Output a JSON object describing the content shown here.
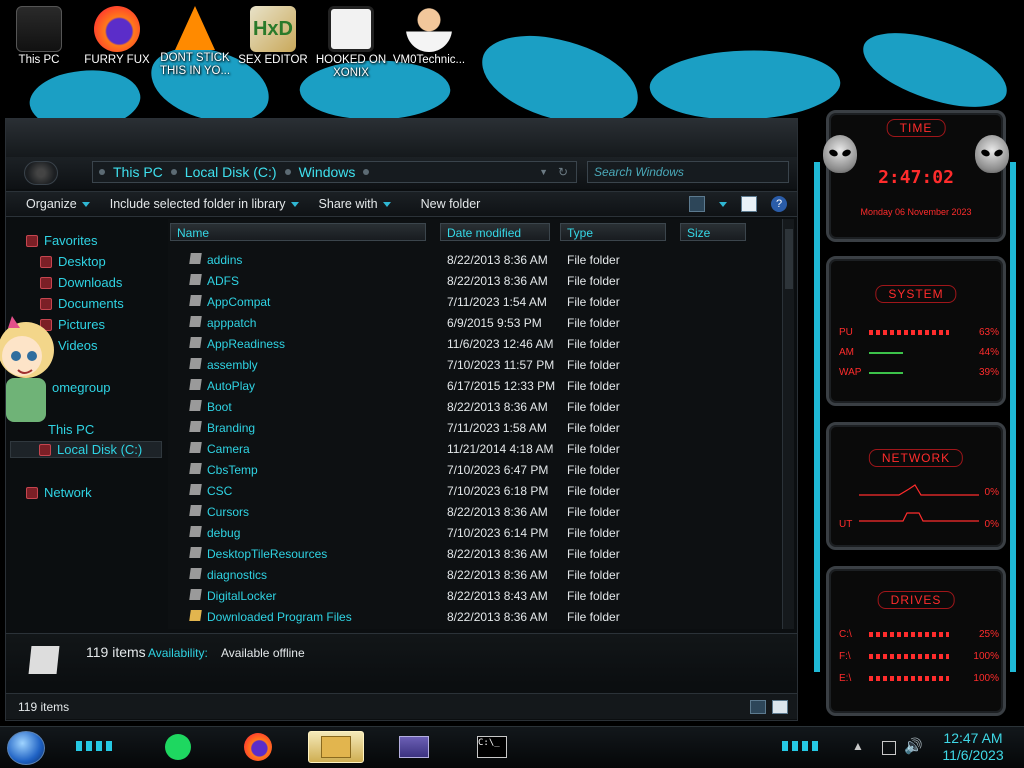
{
  "desktop": {
    "icons": [
      {
        "label": "This PC"
      },
      {
        "label": "FURRY FUX"
      },
      {
        "label": "DONT STICK THIS IN YO..."
      },
      {
        "label": "SEX EDITOR"
      },
      {
        "label": "HOOKED ON XONIX"
      },
      {
        "label": "VM0Technic..."
      }
    ]
  },
  "explorer": {
    "breadcrumb": [
      "This PC",
      "Local Disk (C:)",
      "Windows"
    ],
    "search_placeholder": "Search Windows",
    "toolbar": {
      "organize": "Organize",
      "include": "Include selected folder in library",
      "share": "Share with",
      "new_folder": "New folder"
    },
    "nav": {
      "favorites": "Favorites",
      "desktop": "Desktop",
      "downloads": "Downloads",
      "documents": "Documents",
      "pictures": "Pictures",
      "videos": "Videos",
      "homegroup": "omegroup",
      "this_pc": "This PC",
      "local_disk": "Local Disk (C:)",
      "network": "Network"
    },
    "columns": {
      "name": "Name",
      "date": "Date modified",
      "type": "Type",
      "size": "Size"
    },
    "files": [
      {
        "name": "addins",
        "date": "8/22/2013 8:36 AM",
        "type": "File folder"
      },
      {
        "name": "ADFS",
        "date": "8/22/2013 8:36 AM",
        "type": "File folder"
      },
      {
        "name": "AppCompat",
        "date": "7/11/2023 1:54 AM",
        "type": "File folder"
      },
      {
        "name": "apppatch",
        "date": "6/9/2015 9:53 PM",
        "type": "File folder"
      },
      {
        "name": "AppReadiness",
        "date": "11/6/2023 12:46 AM",
        "type": "File folder"
      },
      {
        "name": "assembly",
        "date": "7/10/2023 11:57 PM",
        "type": "File folder"
      },
      {
        "name": "AutoPlay",
        "date": "6/17/2015 12:33 PM",
        "type": "File folder"
      },
      {
        "name": "Boot",
        "date": "8/22/2013 8:36 AM",
        "type": "File folder"
      },
      {
        "name": "Branding",
        "date": "7/11/2023 1:58 AM",
        "type": "File folder"
      },
      {
        "name": "Camera",
        "date": "11/21/2014 4:18 AM",
        "type": "File folder"
      },
      {
        "name": "CbsTemp",
        "date": "7/10/2023 6:47 PM",
        "type": "File folder"
      },
      {
        "name": "CSC",
        "date": "7/10/2023 6:18 PM",
        "type": "File folder"
      },
      {
        "name": "Cursors",
        "date": "8/22/2013 8:36 AM",
        "type": "File folder"
      },
      {
        "name": "debug",
        "date": "7/10/2023 6:14 PM",
        "type": "File folder"
      },
      {
        "name": "DesktopTileResources",
        "date": "8/22/2013 8:36 AM",
        "type": "File folder"
      },
      {
        "name": "diagnostics",
        "date": "8/22/2013 8:36 AM",
        "type": "File folder"
      },
      {
        "name": "DigitalLocker",
        "date": "8/22/2013 8:43 AM",
        "type": "File folder"
      },
      {
        "name": "Downloaded Program Files",
        "date": "8/22/2013 8:36 AM",
        "type": "File folder"
      }
    ],
    "details": {
      "count": "119 items",
      "availability_label": "Availability:",
      "availability_value": "Available offline"
    },
    "status": "119 items"
  },
  "gadgets": {
    "time": {
      "title": "TIME",
      "clock": "2:47:02",
      "date": "Monday 06 November 2023"
    },
    "system": {
      "title": "SYSTEM",
      "rows": [
        {
          "label": "PU",
          "pct": "63%"
        },
        {
          "label": "AM",
          "pct": "44%"
        },
        {
          "label": "WAP",
          "pct": "39%"
        }
      ]
    },
    "network": {
      "title": "NETWORK",
      "rows": [
        {
          "pct": "0%"
        },
        {
          "label": "UT",
          "pct": "0%"
        }
      ]
    },
    "drives": {
      "title": "DRIVES",
      "rows": [
        {
          "label": "C:\\",
          "pct": "25%"
        },
        {
          "label": "F:\\",
          "pct": "100%"
        },
        {
          "label": "E:\\",
          "pct": "100%"
        }
      ]
    }
  },
  "taskbar": {
    "time": "12:47 AM",
    "date": "11/6/2023"
  }
}
